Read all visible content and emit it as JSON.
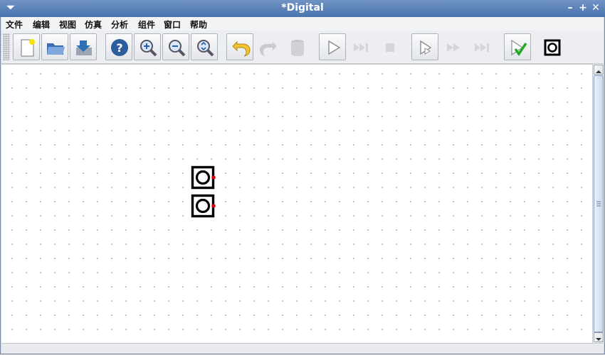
{
  "window": {
    "title": "*Digital"
  },
  "menu": {
    "items": [
      "文件",
      "编辑",
      "视图",
      "仿真",
      "分析",
      "组件",
      "窗口",
      "帮助"
    ]
  },
  "toolbar": {
    "buttons": [
      {
        "icon": "new-file-icon",
        "enabled": true
      },
      {
        "icon": "open-folder-icon",
        "enabled": true
      },
      {
        "icon": "save-icon",
        "enabled": true
      },
      {
        "icon": "help-icon",
        "enabled": true
      },
      {
        "icon": "zoom-in-icon",
        "enabled": true
      },
      {
        "icon": "zoom-out-icon",
        "enabled": true
      },
      {
        "icon": "zoom-fit-icon",
        "enabled": true
      },
      {
        "icon": "undo-icon",
        "enabled": true
      },
      {
        "icon": "redo-icon",
        "enabled": false
      },
      {
        "icon": "delete-icon",
        "enabled": false
      },
      {
        "icon": "run-icon",
        "enabled": true
      },
      {
        "icon": "step-icon",
        "enabled": false
      },
      {
        "icon": "stop-icon",
        "enabled": false
      },
      {
        "icon": "run-to-break-icon",
        "enabled": true
      },
      {
        "icon": "fast-run-icon",
        "enabled": false
      },
      {
        "icon": "micro-step-icon",
        "enabled": false
      },
      {
        "icon": "analyse-check-icon",
        "enabled": true
      },
      {
        "icon": "output-component-icon",
        "enabled": true
      }
    ]
  },
  "canvas": {
    "components": [
      {
        "type": "output-component",
        "pin_color": "#cc0000"
      },
      {
        "type": "output-component",
        "pin_color": "#cc0000"
      }
    ]
  },
  "colors": {
    "accent": "#4a74ad",
    "pin": "#cc0000"
  }
}
